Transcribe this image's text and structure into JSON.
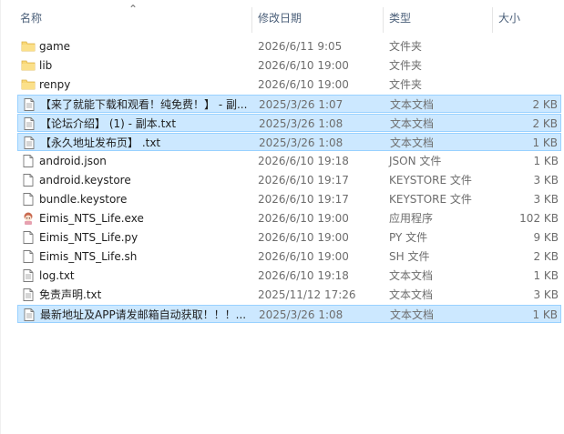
{
  "columns": {
    "name": "名称",
    "date": "修改日期",
    "type": "类型",
    "size": "大小"
  },
  "files": [
    {
      "name": "game",
      "date": "2026/6/11 9:05",
      "type": "文件夹",
      "size": "",
      "icon": "folder-icon",
      "selected": false
    },
    {
      "name": "lib",
      "date": "2026/6/10 19:00",
      "type": "文件夹",
      "size": "",
      "icon": "folder-icon",
      "selected": false
    },
    {
      "name": "renpy",
      "date": "2026/6/10 19:00",
      "type": "文件夹",
      "size": "",
      "icon": "folder-icon",
      "selected": false
    },
    {
      "name": "【来了就能下载和观看！纯免费！】 - 副...",
      "date": "2025/3/26 1:07",
      "type": "文本文档",
      "size": "2 KB",
      "icon": "text-file-icon",
      "selected": true
    },
    {
      "name": "【论坛介绍】 (1) - 副本.txt",
      "date": "2025/3/26 1:08",
      "type": "文本文档",
      "size": "2 KB",
      "icon": "text-file-icon",
      "selected": true
    },
    {
      "name": "【永久地址发布页】 .txt",
      "date": "2025/3/26 1:08",
      "type": "文本文档",
      "size": "1 KB",
      "icon": "text-file-icon",
      "selected": true
    },
    {
      "name": "android.json",
      "date": "2026/6/10 19:18",
      "type": "JSON 文件",
      "size": "1 KB",
      "icon": "file-icon",
      "selected": false
    },
    {
      "name": "android.keystore",
      "date": "2026/6/10 19:17",
      "type": "KEYSTORE 文件",
      "size": "3 KB",
      "icon": "file-icon",
      "selected": false
    },
    {
      "name": "bundle.keystore",
      "date": "2026/6/10 19:17",
      "type": "KEYSTORE 文件",
      "size": "3 KB",
      "icon": "file-icon",
      "selected": false
    },
    {
      "name": "Eimis_NTS_Life.exe",
      "date": "2026/6/10 19:00",
      "type": "应用程序",
      "size": "102 KB",
      "icon": "app-icon",
      "selected": false
    },
    {
      "name": "Eimis_NTS_Life.py",
      "date": "2026/6/10 19:00",
      "type": "PY 文件",
      "size": "9 KB",
      "icon": "file-icon",
      "selected": false
    },
    {
      "name": "Eimis_NTS_Life.sh",
      "date": "2026/6/10 19:00",
      "type": "SH 文件",
      "size": "2 KB",
      "icon": "file-icon",
      "selected": false
    },
    {
      "name": "log.txt",
      "date": "2026/6/10 19:18",
      "type": "文本文档",
      "size": "1 KB",
      "icon": "text-file-icon",
      "selected": false
    },
    {
      "name": "免责声明.txt",
      "date": "2025/11/12 17:26",
      "type": "文本文档",
      "size": "3 KB",
      "icon": "text-file-icon",
      "selected": false
    },
    {
      "name": "最新地址及APP请发邮箱自动获取！！！...",
      "date": "2025/3/26 1:08",
      "type": "文本文档",
      "size": "1 KB",
      "icon": "text-file-icon",
      "selected": true
    }
  ],
  "colors": {
    "selection_bg": "#cce8ff",
    "selection_border": "#99d1ff",
    "header_text": "#4c607a",
    "folder": "#f8d775"
  }
}
